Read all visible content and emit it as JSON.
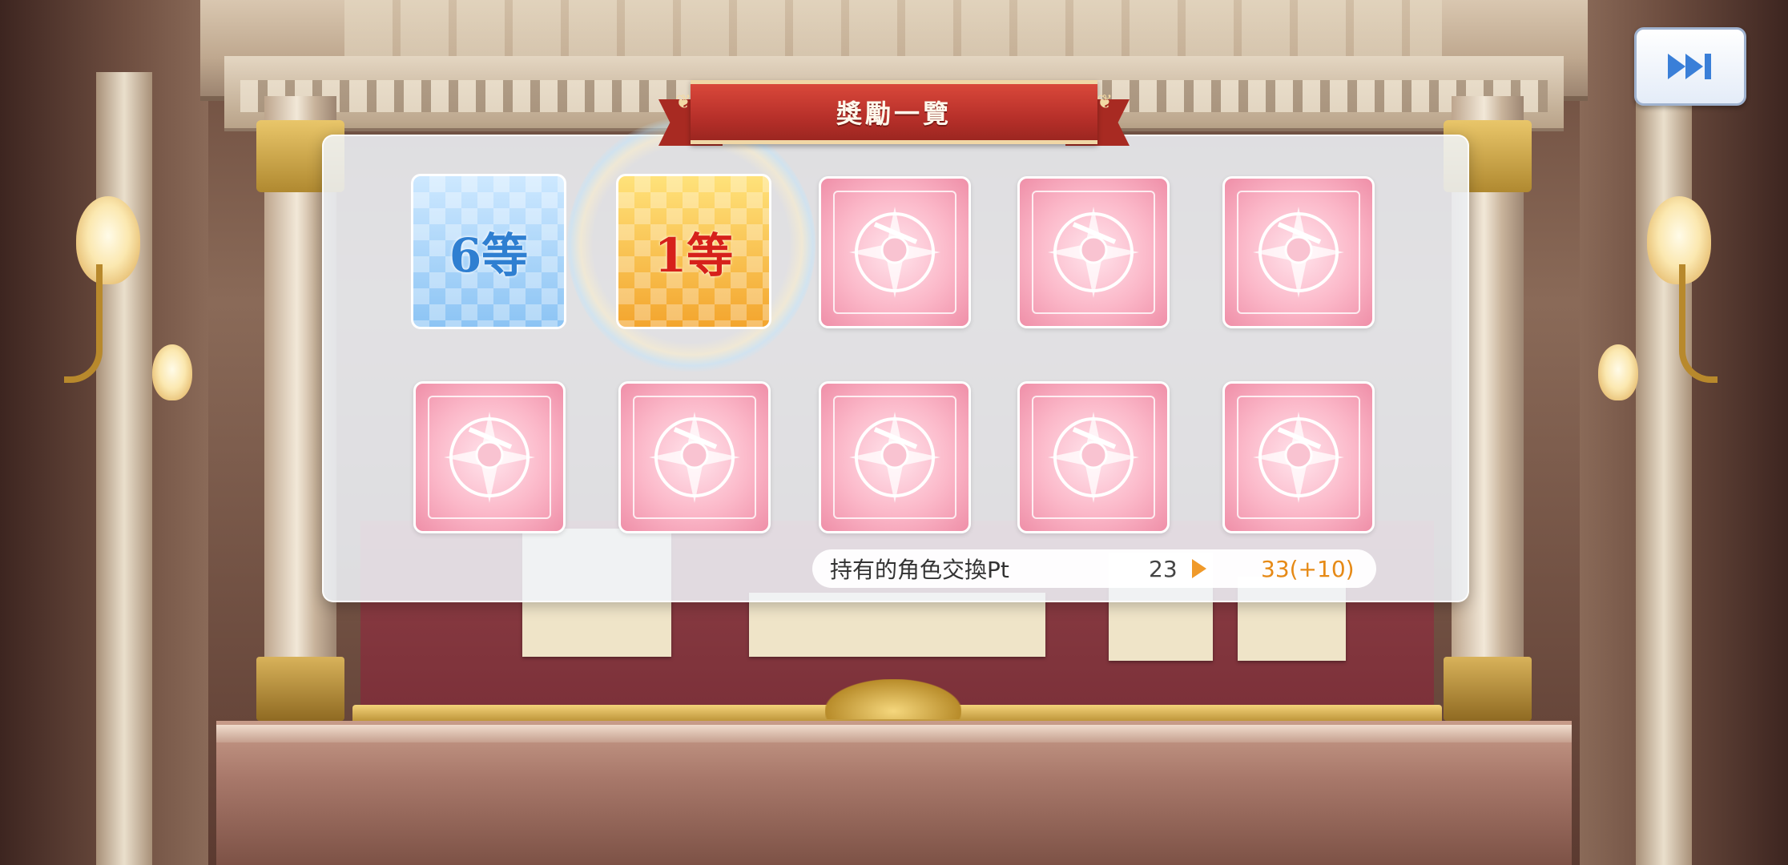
{
  "header": {
    "title": "獎勵一覽",
    "skip_icon": "fast-forward-icon"
  },
  "rewards": {
    "row1": [
      {
        "kind": "rank",
        "label": "6等",
        "color": "#2f7fd1"
      },
      {
        "kind": "rank",
        "label": "1等",
        "color": "#d6211b"
      },
      {
        "kind": "character-exchange-medal",
        "icon": "sword-knight-emblem-icon"
      },
      {
        "kind": "character-exchange-medal",
        "icon": "sword-knight-emblem-icon"
      },
      {
        "kind": "character-exchange-medal",
        "icon": "sword-knight-emblem-icon"
      }
    ],
    "row2": [
      {
        "kind": "character-exchange-medal",
        "icon": "sword-knight-emblem-icon"
      },
      {
        "kind": "character-exchange-medal",
        "icon": "sword-knight-emblem-icon"
      },
      {
        "kind": "character-exchange-medal",
        "icon": "sword-knight-emblem-icon"
      },
      {
        "kind": "character-exchange-medal",
        "icon": "sword-knight-emblem-icon"
      },
      {
        "kind": "character-exchange-medal",
        "icon": "sword-knight-emblem-icon"
      }
    ]
  },
  "points": {
    "label": "持有的角色交換Pt",
    "current": "23",
    "after": "33(+10)",
    "arrow_icon": "triangle-right-icon"
  },
  "colors": {
    "banner": "#b7302a",
    "accent_orange": "#e68a16",
    "medal_pink": "#fbb7c8"
  }
}
